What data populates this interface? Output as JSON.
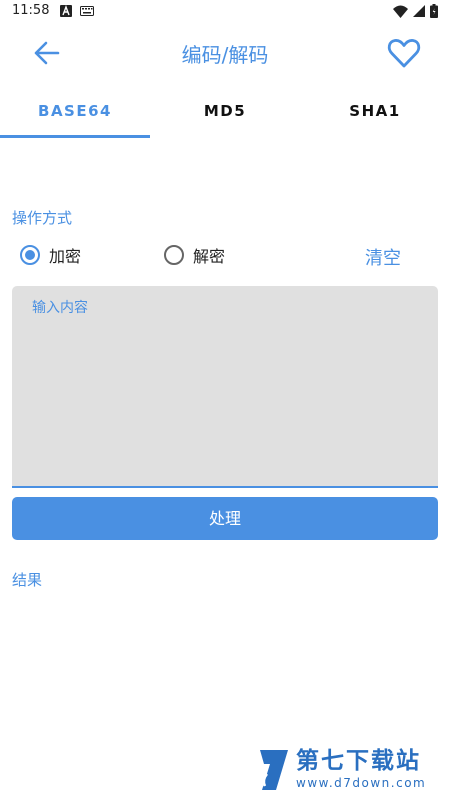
{
  "status_bar": {
    "time": "11:58",
    "left_icons": [
      "notification-a-icon",
      "keyboard-icon"
    ],
    "right_icons": [
      "wifi-icon",
      "cell-signal-icon",
      "battery-icon"
    ]
  },
  "app_bar": {
    "title": "编码/解码",
    "back_icon": "arrow-left-icon",
    "favorite_icon": "heart-outline-icon"
  },
  "tabs": [
    {
      "label": "BASE64",
      "active": true
    },
    {
      "label": "MD5",
      "active": false
    },
    {
      "label": "SHA1",
      "active": false
    }
  ],
  "mode": {
    "section_label": "操作方式",
    "options": [
      {
        "label": "加密",
        "checked": true
      },
      {
        "label": "解密",
        "checked": false
      }
    ],
    "clear_label": "清空"
  },
  "input": {
    "placeholder": "输入内容",
    "value": ""
  },
  "process_button": {
    "label": "处理"
  },
  "result": {
    "label": "结果",
    "value": ""
  },
  "watermark": {
    "title": "第七下载站",
    "url": "www.d7down.com"
  },
  "colors": {
    "accent": "#4a90e2",
    "input_bg": "#e0e0e0",
    "watermark": "#2a6fc0"
  }
}
